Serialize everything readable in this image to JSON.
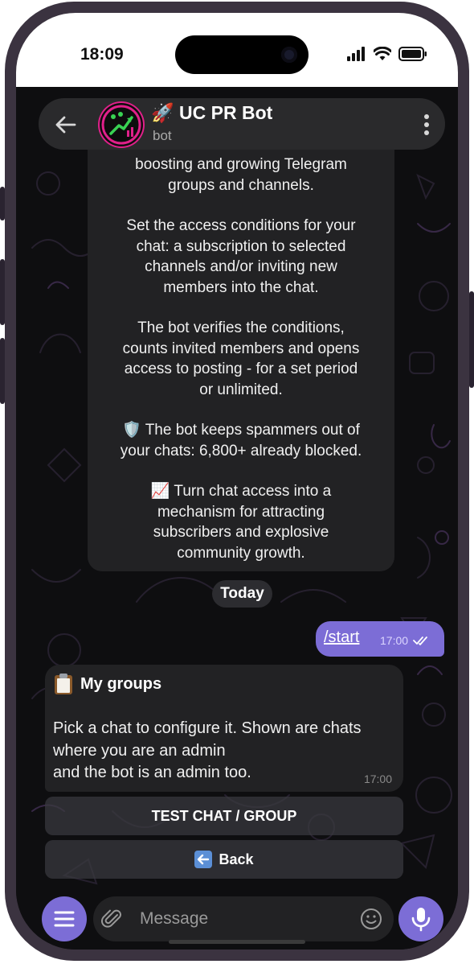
{
  "status_bar": {
    "time": "18:09"
  },
  "header": {
    "title": "🚀 UC PR Bot",
    "subtitle": "bot"
  },
  "intro_message": {
    "paragraphs": [
      [
        "boosting and growing Telegram",
        "groups and channels."
      ],
      [
        "Set the access conditions for your",
        "chat: a subscription to selected",
        "channels and/or inviting new",
        "members into the chat."
      ],
      [
        "The bot verifies the conditions,",
        "counts invited members and opens",
        "access to posting - for a set period",
        "or unlimited."
      ],
      [
        "🛡️ The bot keeps spammers out of",
        "your chats: 6,800+ already blocked."
      ],
      [
        "📈 Turn chat access into a",
        "mechanism for attracting",
        "subscribers and explosive",
        "community growth."
      ]
    ]
  },
  "date_separator": "Today",
  "outgoing_message": {
    "text": "/start",
    "time": "17:00"
  },
  "groups_message": {
    "title": "My groups",
    "body_lines": [
      "Pick a chat to configure it. Shown are chats",
      "where you are an admin",
      "and the bot is an admin too."
    ],
    "time": "17:00"
  },
  "keyboard": [
    {
      "label": "TEST CHAT / GROUP"
    },
    {
      "label": "Back"
    }
  ],
  "input": {
    "placeholder": "Message"
  },
  "colors": {
    "accent": "#7c6dd6",
    "bubble": "#222224",
    "header": "#2a2a2c",
    "background": "#0e0e10"
  }
}
